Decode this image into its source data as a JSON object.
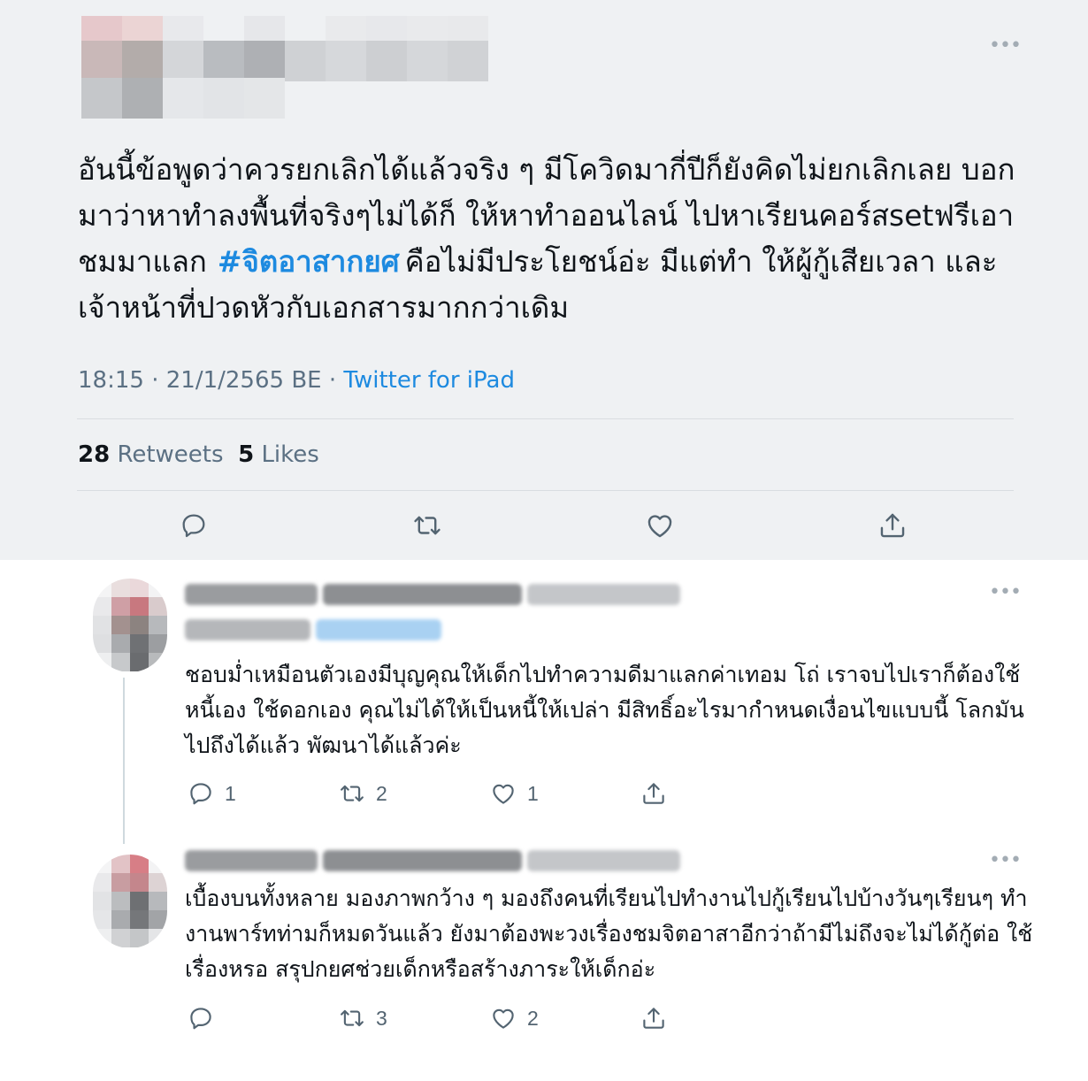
{
  "main_tweet": {
    "text": "อันนี้ข้อพูดว่าควรยกเลิกได้แล้วจริง ๆ มีโควิดมากี่ปีก็ยังคิดไม่ยกเลิกเลย บอกมาว่าหาทำลงพื้นที่จริงๆไม่ได้ก็ ให้หาทำออนไลน์ ไปหาเรียนคอร์สsetฟรีเอาชมมาแลก",
    "hashtag": "#จิตอาสากยศ",
    "text_after": "คือไม่มีประโยชน์อ่ะ มีแต่ทำ ให้ผู้กู้เสียเวลา และเจ้าหน้าที่ปวดหัวกับเอกสารมากกว่าเดิม",
    "time": "18:15",
    "separator": "·",
    "date": "21/1/2565 BE",
    "source": "Twitter for iPad",
    "retweets_count": "28",
    "retweets_label": "Retweets",
    "likes_count": "5",
    "likes_label": "Likes"
  },
  "replies": [
    {
      "text": "ชอบม่ำเหมือนตัวเองมีบุญคุณให้เด็กไปทำความดีมาแลกค่าเทอม โถ่ เราจบไปเราก็ต้องใช้หนี้เอง ใช้ดอกเอง คุณไม่ได้ให้เป็นหนี้ให้เปล่า มีสิทธิ์อะไรมากำหนดเงื่อนไขแบบนี้ โลกมันไปถึงได้แล้ว พัฒนาได้แล้วค่ะ",
      "reply_count": "1",
      "retweet_count": "2",
      "like_count": "1"
    },
    {
      "text": "เบื้องบนทั้งหลาย มองภาพกว้าง ๆ มองถึงคนที่เรียนไปทำงานไปกู้เรียนไปบ้างวันๆเรียนๆ ทำงานพาร์ทท่ามก็หมดวันแล้ว ยังมาต้องพะวงเรื่องชมจิตอาสาอีกว่าถ้ามีไม่ถึงจะไม่ได้กู้ต่อ ใช้เรื่องหรอ สรุปกยศช่วยเด็กหรือสร้างภาระให้เด็กอ่ะ",
      "reply_count": "",
      "retweet_count": "3",
      "like_count": "2"
    }
  ],
  "icons": {
    "more": "more-dots-icon",
    "reply": "reply-bubble-icon",
    "retweet": "retweet-icon",
    "like": "heart-icon",
    "share": "share-icon"
  },
  "colors": {
    "accent": "#1d8ae0",
    "main_bg": "#eff1f3",
    "muted_text": "#5b7083",
    "icon": "#536471"
  }
}
